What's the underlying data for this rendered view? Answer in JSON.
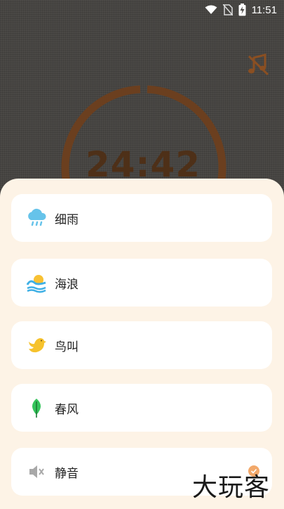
{
  "status_bar": {
    "time": "11:51",
    "icons": [
      "wifi-icon",
      "no-sim-icon",
      "battery-charging-icon"
    ]
  },
  "timer": {
    "display": "24:42",
    "ring_color": "#6b3f1f"
  },
  "music_button": {
    "icon": "music-off-icon",
    "color": "#8a4f22"
  },
  "sound_list": {
    "items": [
      {
        "label": "细雨",
        "icon": "rain-cloud-icon"
      },
      {
        "label": "海浪",
        "icon": "sea-wave-sun-icon"
      },
      {
        "label": "鸟叫",
        "icon": "bird-icon"
      },
      {
        "label": "春风",
        "icon": "leaf-icon"
      },
      {
        "label": "静音",
        "icon": "mute-speaker-icon",
        "selected": true
      }
    ]
  },
  "watermark": "大玩客",
  "colors": {
    "sheet_bg": "#fdf3e6",
    "card_bg": "#ffffff",
    "selected_badge": "#f2a86a"
  }
}
